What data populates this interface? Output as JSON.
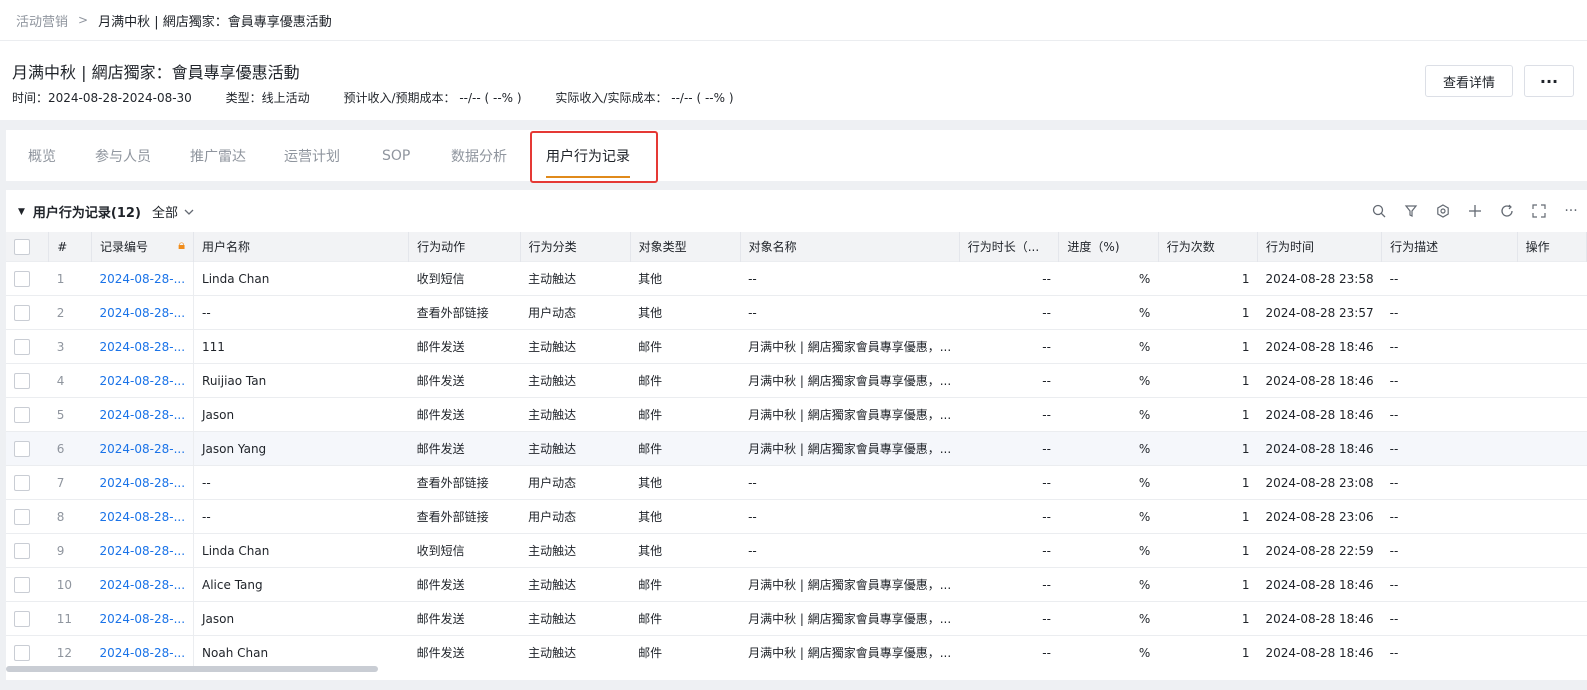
{
  "breadcrumb": {
    "root": "活动营销",
    "current": "月满中秋 | 網店獨家：會員專享優惠活動"
  },
  "header": {
    "title": "月满中秋 | 網店獨家：會員專享優惠活動",
    "time": "时间：2024-08-28-2024-08-30",
    "type": "类型：线上活动",
    "expected": "预计收入/预期成本：  --/-- ( --% )",
    "actual": "实际收入/实际成本：  --/-- ( --% )",
    "detail_button": "查看详情",
    "more_button": "···"
  },
  "tabs": [
    "概览",
    "参与人员",
    "推广雷达",
    "运营计划",
    "SOP",
    "数据分析",
    "用户行为记录"
  ],
  "active_tab": "用户行为记录",
  "accent_color": "#e08a1b",
  "table_panel": {
    "title": "用户行为记录(12)",
    "filter": "全部",
    "toolbar_icons": [
      "search-icon",
      "filter-icon",
      "settings-icon",
      "add-icon",
      "refresh-icon",
      "fullscreen-icon",
      "more-icon"
    ]
  },
  "table": {
    "headers": [
      "#",
      "记录编号",
      "用户名称",
      "行为动作",
      "行为分类",
      "对象类型",
      "对象名称",
      "行为时长（...",
      "进度（%)",
      "行为次数",
      "行为时间",
      "行为描述",
      "操作"
    ],
    "rows": [
      [
        "1",
        "2024-08-28-...",
        "Linda Chan",
        "收到短信",
        "主动触达",
        "其他",
        "--",
        "--",
        "%",
        "1",
        "2024-08-28 23:58",
        "--"
      ],
      [
        "2",
        "2024-08-28-...",
        "--",
        "查看外部链接",
        "用户动态",
        "其他",
        "--",
        "--",
        "%",
        "1",
        "2024-08-28 23:57",
        "--"
      ],
      [
        "3",
        "2024-08-28-...",
        "111",
        "邮件发送",
        "主动触达",
        "邮件",
        "月满中秋 | 網店獨家會員專享優惠，...",
        "--",
        "%",
        "1",
        "2024-08-28 18:46",
        "--"
      ],
      [
        "4",
        "2024-08-28-...",
        "Ruijiao Tan",
        "邮件发送",
        "主动触达",
        "邮件",
        "月满中秋 | 網店獨家會員專享優惠，...",
        "--",
        "%",
        "1",
        "2024-08-28 18:46",
        "--"
      ],
      [
        "5",
        "2024-08-28-...",
        "Jason",
        "邮件发送",
        "主动触达",
        "邮件",
        "月满中秋 | 網店獨家會員專享優惠，...",
        "--",
        "%",
        "1",
        "2024-08-28 18:46",
        "--"
      ],
      [
        "6",
        "2024-08-28-...",
        "Jason Yang",
        "邮件发送",
        "主动触达",
        "邮件",
        "月满中秋 | 網店獨家會員專享優惠，...",
        "--",
        "%",
        "1",
        "2024-08-28 18:46",
        "--"
      ],
      [
        "7",
        "2024-08-28-...",
        "--",
        "查看外部链接",
        "用户动态",
        "其他",
        "--",
        "--",
        "%",
        "1",
        "2024-08-28 23:08",
        "--"
      ],
      [
        "8",
        "2024-08-28-...",
        "--",
        "查看外部链接",
        "用户动态",
        "其他",
        "--",
        "--",
        "%",
        "1",
        "2024-08-28 23:06",
        "--"
      ],
      [
        "9",
        "2024-08-28-...",
        "Linda Chan",
        "收到短信",
        "主动触达",
        "其他",
        "--",
        "--",
        "%",
        "1",
        "2024-08-28 22:59",
        "--"
      ],
      [
        "10",
        "2024-08-28-...",
        "Alice Tang",
        "邮件发送",
        "主动触达",
        "邮件",
        "月满中秋 | 網店獨家會員專享優惠，...",
        "--",
        "%",
        "1",
        "2024-08-28 18:46",
        "--"
      ],
      [
        "11",
        "2024-08-28-...",
        "Jason",
        "邮件发送",
        "主动触达",
        "邮件",
        "月满中秋 | 網店獨家會員專享優惠，...",
        "--",
        "%",
        "1",
        "2024-08-28 18:46",
        "--"
      ],
      [
        "12",
        "2024-08-28-...",
        "Noah Chan",
        "邮件发送",
        "主动触达",
        "邮件",
        "月满中秋 | 網店獨家會員專享優惠，...",
        "--",
        "%",
        "1",
        "2024-08-28 18:46",
        "--"
      ]
    ]
  }
}
